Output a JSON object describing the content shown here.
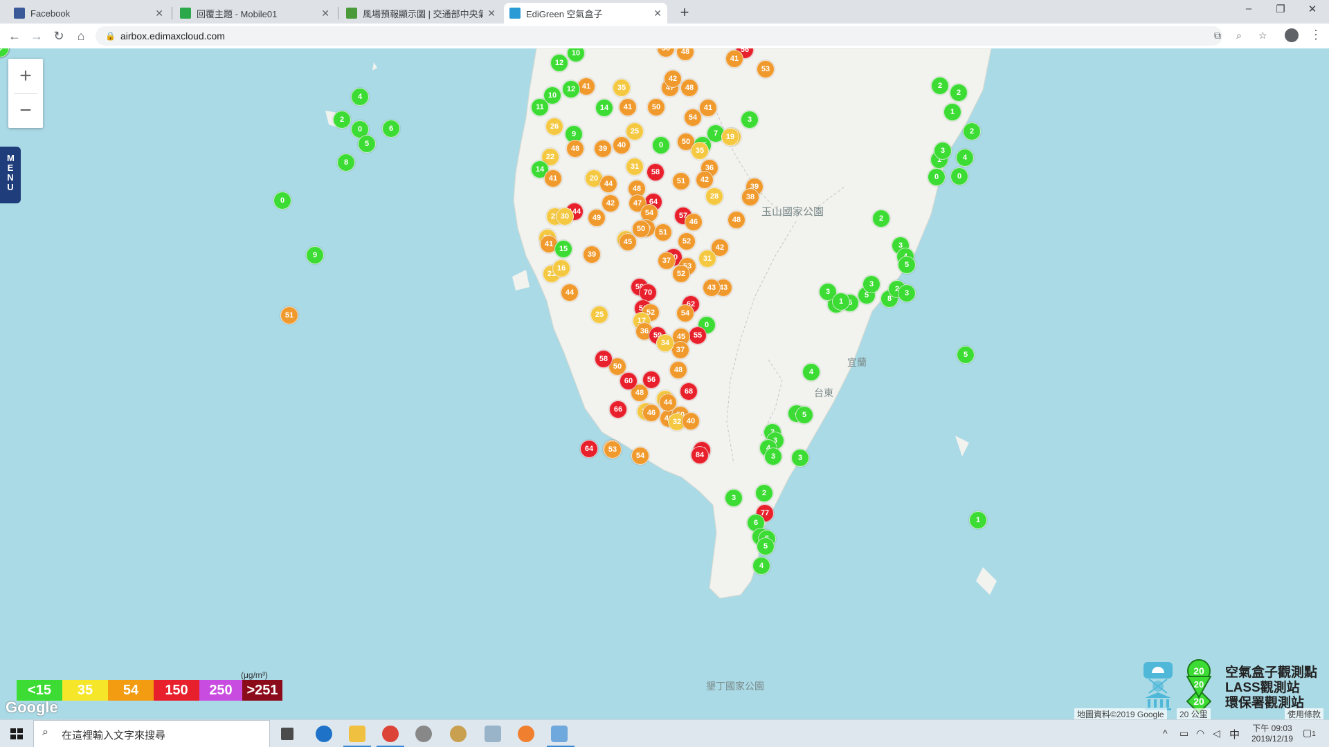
{
  "tabs": [
    {
      "title": "Facebook",
      "favicon_color": "#3b5998",
      "active": false
    },
    {
      "title": "回覆主題 - Mobile01",
      "favicon_color": "#2aa84a",
      "active": false
    },
    {
      "title": "風場預報顯示圖 | 交通部中央氣象局",
      "favicon_color": "#4a9a3a",
      "active": false
    },
    {
      "title": "EdiGreen 空氣盒子",
      "favicon_color": "#2b9bd6",
      "active": true
    }
  ],
  "toolbar": {
    "url": "airbox.edimaxcloud.com"
  },
  "map": {
    "zoom_in": "+",
    "zoom_out": "−",
    "menu_label": "MENU",
    "park_label": "玉山國家公園",
    "place_labels": [
      "台東",
      "宜蘭",
      "墾丁國家公園"
    ],
    "attribution": "地圖資料©2019 Google",
    "scale_label": "20 公里",
    "terms": "使用條款",
    "google_logo": "Google"
  },
  "legend_scale": {
    "unit": "(μg/m³)",
    "items": [
      {
        "label": "<15",
        "color": "#3ddc34"
      },
      {
        "label": "35",
        "color": "#f5e62a"
      },
      {
        "label": "54",
        "color": "#f39c12"
      },
      {
        "label": "150",
        "color": "#e8202c"
      },
      {
        "label": "250",
        "color": "#c94ce0"
      },
      {
        "label": ">251",
        "color": "#8b0b1a"
      }
    ]
  },
  "legend": [
    {
      "value": "20",
      "label": "空氣盒子觀測點",
      "shape": "circle"
    },
    {
      "value": "20",
      "label": "環保署觀測站",
      "shape": "diamond"
    },
    {
      "value": "20",
      "label": "LASS觀測站",
      "shape": "triangle"
    }
  ],
  "markers": [
    {
      "v": "4",
      "c": "g"
    },
    {
      "v": "2",
      "c": "g"
    },
    {
      "v": "0",
      "c": "g"
    },
    {
      "v": "5",
      "c": "g"
    },
    {
      "v": "6",
      "c": "g"
    },
    {
      "v": "0",
      "c": "g"
    },
    {
      "v": "8",
      "c": "g"
    },
    {
      "v": "9",
      "c": "g"
    },
    {
      "v": "51",
      "c": "o"
    },
    {
      "v": "56",
      "c": "r"
    },
    {
      "v": "41",
      "c": "o"
    },
    {
      "v": "53",
      "c": "o"
    },
    {
      "v": "3",
      "c": "g"
    },
    {
      "v": "19",
      "c": "y"
    },
    {
      "v": "50",
      "c": "o"
    },
    {
      "v": "48",
      "c": "o"
    },
    {
      "v": "10",
      "c": "g"
    },
    {
      "v": "12",
      "c": "g"
    },
    {
      "v": "41",
      "c": "o"
    },
    {
      "v": "35",
      "c": "y"
    },
    {
      "v": "47",
      "c": "o"
    },
    {
      "v": "42",
      "c": "o"
    },
    {
      "v": "48",
      "c": "o"
    },
    {
      "v": "10",
      "c": "g"
    },
    {
      "v": "12",
      "c": "g"
    },
    {
      "v": "14",
      "c": "g"
    },
    {
      "v": "41",
      "c": "o"
    },
    {
      "v": "50",
      "c": "o"
    },
    {
      "v": "41",
      "c": "o"
    },
    {
      "v": "11",
      "c": "g"
    },
    {
      "v": "26",
      "c": "y"
    },
    {
      "v": "9",
      "c": "g"
    },
    {
      "v": "48",
      "c": "o"
    },
    {
      "v": "39",
      "c": "o"
    },
    {
      "v": "40",
      "c": "o"
    },
    {
      "v": "25",
      "c": "y"
    },
    {
      "v": "54",
      "c": "o"
    },
    {
      "v": "50",
      "c": "o"
    },
    {
      "v": "0",
      "c": "g"
    },
    {
      "v": "7",
      "c": "g"
    },
    {
      "v": "15",
      "c": "g"
    },
    {
      "v": "19",
      "c": "y"
    },
    {
      "v": "35",
      "c": "y"
    },
    {
      "v": "22",
      "c": "y"
    },
    {
      "v": "58",
      "c": "r"
    },
    {
      "v": "31",
      "c": "y"
    },
    {
      "v": "36",
      "c": "o"
    },
    {
      "v": "14",
      "c": "g"
    },
    {
      "v": "41",
      "c": "o"
    },
    {
      "v": "20",
      "c": "y"
    },
    {
      "v": "44",
      "c": "o"
    },
    {
      "v": "48",
      "c": "o"
    },
    {
      "v": "51",
      "c": "o"
    },
    {
      "v": "42",
      "c": "o"
    },
    {
      "v": "39",
      "c": "o"
    },
    {
      "v": "38",
      "c": "o"
    },
    {
      "v": "28",
      "c": "y"
    },
    {
      "v": "64",
      "c": "r"
    },
    {
      "v": "144",
      "c": "r"
    },
    {
      "v": "47",
      "c": "o"
    },
    {
      "v": "42",
      "c": "o"
    },
    {
      "v": "54",
      "c": "o"
    },
    {
      "v": "57",
      "c": "r"
    },
    {
      "v": "46",
      "c": "o"
    },
    {
      "v": "48",
      "c": "o"
    },
    {
      "v": "25",
      "c": "y"
    },
    {
      "v": "30",
      "c": "y"
    },
    {
      "v": "49",
      "c": "o"
    },
    {
      "v": "40",
      "c": "o"
    },
    {
      "v": "50",
      "c": "o"
    },
    {
      "v": "51",
      "c": "o"
    },
    {
      "v": "32",
      "c": "y"
    },
    {
      "v": "22",
      "c": "y"
    },
    {
      "v": "41",
      "c": "o"
    },
    {
      "v": "15",
      "c": "g"
    },
    {
      "v": "39",
      "c": "o"
    },
    {
      "v": "45",
      "c": "o"
    },
    {
      "v": "52",
      "c": "o"
    },
    {
      "v": "42",
      "c": "o"
    },
    {
      "v": "70",
      "c": "r"
    },
    {
      "v": "31",
      "c": "y"
    },
    {
      "v": "53",
      "c": "o"
    },
    {
      "v": "37",
      "c": "o"
    },
    {
      "v": "52",
      "c": "o"
    },
    {
      "v": "21",
      "c": "y"
    },
    {
      "v": "16",
      "c": "y"
    },
    {
      "v": "58",
      "c": "r"
    },
    {
      "v": "70",
      "c": "r"
    },
    {
      "v": "44",
      "c": "o"
    },
    {
      "v": "43",
      "c": "o"
    },
    {
      "v": "43",
      "c": "o"
    },
    {
      "v": "0",
      "c": "g"
    },
    {
      "v": "62",
      "c": "r"
    },
    {
      "v": "56",
      "c": "r"
    },
    {
      "v": "52",
      "c": "o"
    },
    {
      "v": "54",
      "c": "o"
    },
    {
      "v": "25",
      "c": "y"
    },
    {
      "v": "17",
      "c": "y"
    },
    {
      "v": "36",
      "c": "o"
    },
    {
      "v": "59",
      "c": "r"
    },
    {
      "v": "55",
      "c": "r"
    },
    {
      "v": "45",
      "c": "o"
    },
    {
      "v": "37",
      "c": "o"
    },
    {
      "v": "34",
      "c": "y"
    },
    {
      "v": "50",
      "c": "o"
    },
    {
      "v": "48",
      "c": "o"
    },
    {
      "v": "56",
      "c": "r"
    },
    {
      "v": "58",
      "c": "r"
    },
    {
      "v": "26",
      "c": "y"
    },
    {
      "v": "48",
      "c": "o"
    },
    {
      "v": "60",
      "c": "r"
    },
    {
      "v": "66",
      "c": "r"
    },
    {
      "v": "27",
      "c": "y"
    },
    {
      "v": "46",
      "c": "o"
    },
    {
      "v": "42",
      "c": "o"
    },
    {
      "v": "50",
      "c": "o"
    },
    {
      "v": "32",
      "c": "y"
    },
    {
      "v": "40",
      "c": "o"
    },
    {
      "v": "54",
      "c": "o"
    },
    {
      "v": "64",
      "c": "r"
    },
    {
      "v": "51",
      "c": "o"
    },
    {
      "v": "62",
      "c": "r"
    },
    {
      "v": "68",
      "c": "r"
    },
    {
      "v": "44",
      "c": "o"
    },
    {
      "v": "84",
      "c": "r"
    },
    {
      "v": "53",
      "c": "o"
    },
    {
      "v": "3",
      "c": "g"
    },
    {
      "v": "2",
      "c": "g"
    },
    {
      "v": "77",
      "c": "r"
    },
    {
      "v": "6",
      "c": "g"
    },
    {
      "v": "4",
      "c": "g"
    },
    {
      "v": "5",
      "c": "g"
    },
    {
      "v": "4",
      "c": "g"
    },
    {
      "v": "5",
      "c": "g"
    },
    {
      "v": "3",
      "c": "g"
    },
    {
      "v": "3",
      "c": "g"
    },
    {
      "v": "4",
      "c": "g"
    },
    {
      "v": "4",
      "c": "g"
    },
    {
      "v": "4",
      "c": "g"
    },
    {
      "v": "5",
      "c": "g"
    },
    {
      "v": "3",
      "c": "g"
    },
    {
      "v": "3",
      "c": "g"
    },
    {
      "v": "9",
      "c": "g"
    },
    {
      "v": "5",
      "c": "g"
    },
    {
      "v": "3",
      "c": "g"
    },
    {
      "v": "1",
      "c": "g"
    },
    {
      "v": "5",
      "c": "g"
    },
    {
      "v": "3",
      "c": "g"
    },
    {
      "v": "8",
      "c": "g"
    },
    {
      "v": "2",
      "c": "g"
    },
    {
      "v": "3",
      "c": "g"
    },
    {
      "v": "2",
      "c": "g"
    },
    {
      "v": "3",
      "c": "g"
    },
    {
      "v": "4",
      "c": "g"
    },
    {
      "v": "5",
      "c": "g"
    },
    {
      "v": "2",
      "c": "g"
    },
    {
      "v": "2",
      "c": "g"
    },
    {
      "v": "1",
      "c": "g"
    },
    {
      "v": "2",
      "c": "g"
    },
    {
      "v": "1",
      "c": "g"
    },
    {
      "v": "3",
      "c": "g"
    },
    {
      "v": "0",
      "c": "g"
    },
    {
      "v": "0",
      "c": "g"
    },
    {
      "v": "4",
      "c": "g"
    },
    {
      "v": "5",
      "c": "g"
    },
    {
      "v": "1",
      "c": "g"
    },
    {
      "v": "2",
      "c": "g"
    },
    {
      "v": "2",
      "c": "g"
    },
    {
      "v": "0",
      "c": "g"
    },
    {
      "v": "5",
      "c": "g"
    },
    {
      "v": "9",
      "c": "g"
    }
  ],
  "taskbar": {
    "search_placeholder": "在這裡輸入文字來搜尋",
    "time": "下午 09:03",
    "date": "2019/12/19",
    "ime": "中",
    "notification_count": "1"
  }
}
